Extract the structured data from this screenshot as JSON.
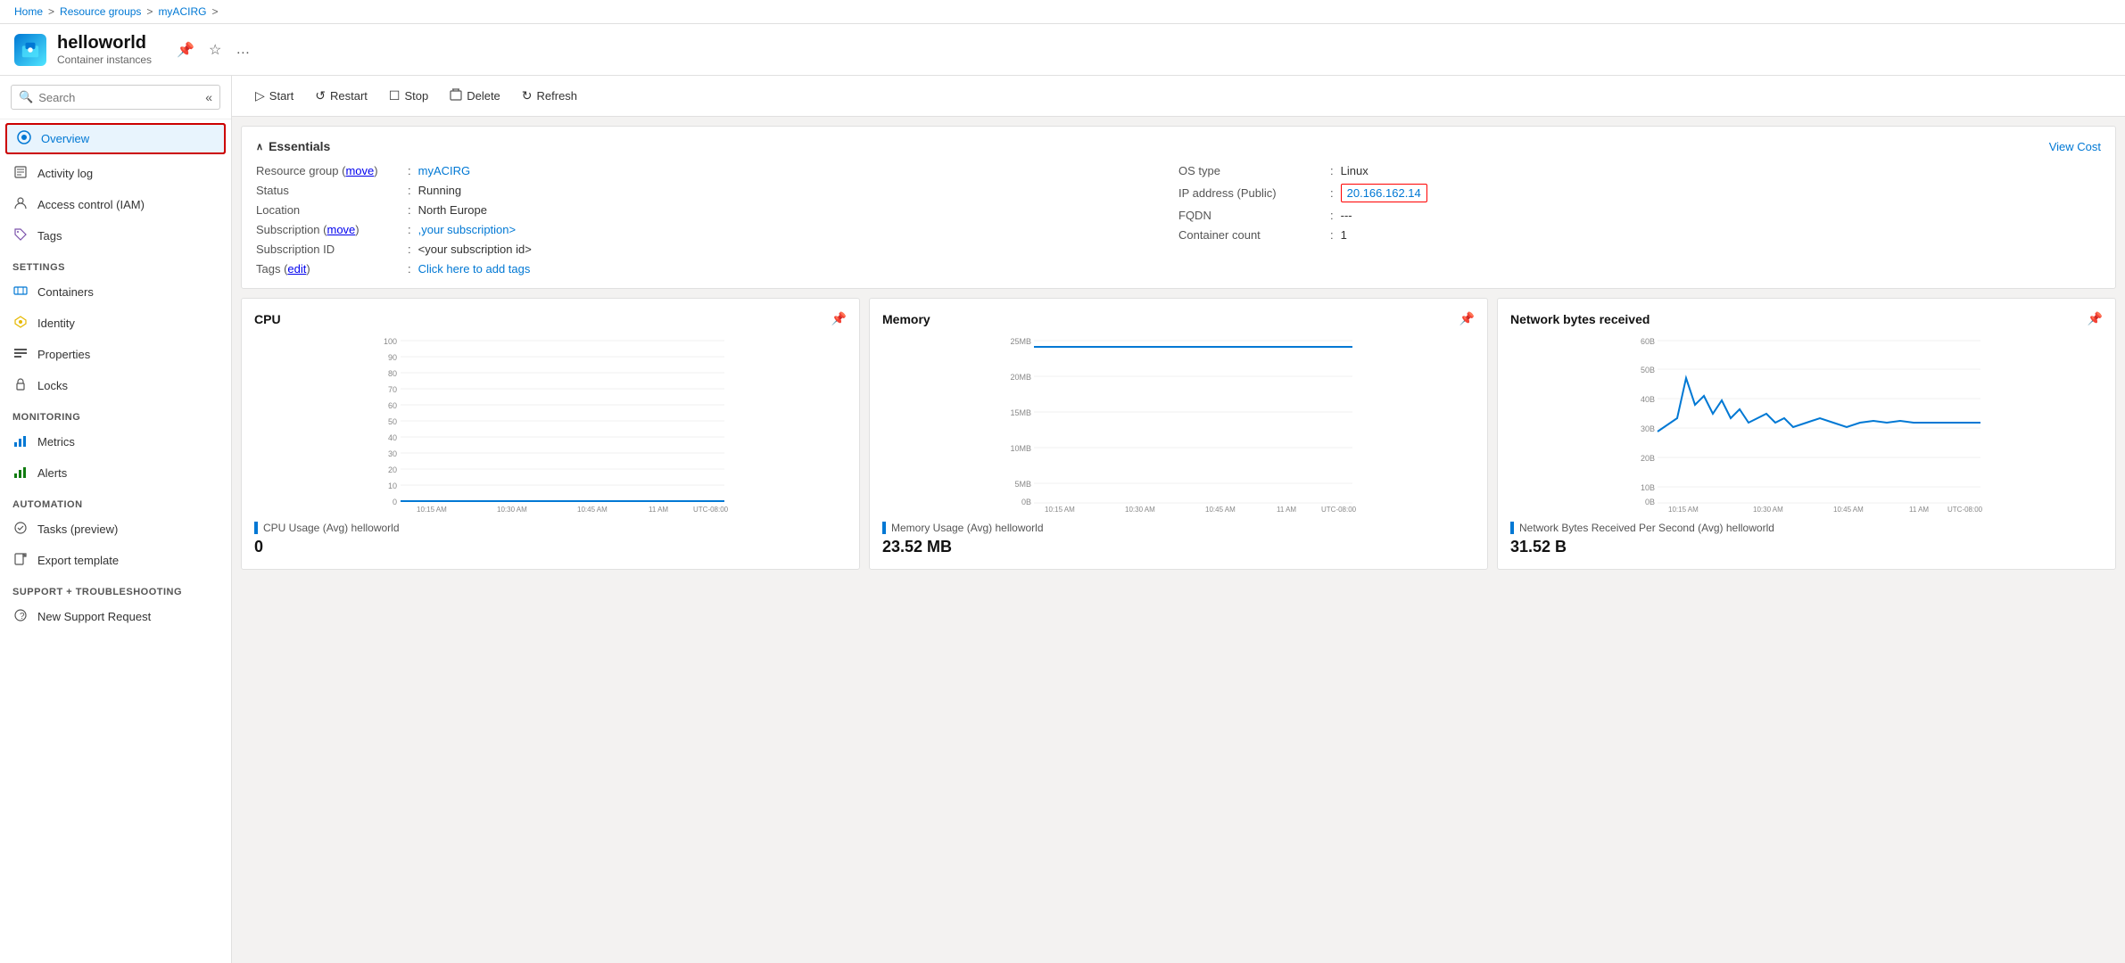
{
  "breadcrumb": {
    "items": [
      "Home",
      "Resource groups",
      "myACIRG"
    ],
    "separators": [
      ">",
      ">",
      ">"
    ]
  },
  "header": {
    "icon": "📦",
    "title": "helloworld",
    "subtitle": "Container instances",
    "actions": [
      "pin-icon",
      "favorite-icon",
      "more-icon"
    ]
  },
  "toolbar": {
    "buttons": [
      {
        "id": "start",
        "label": "Start",
        "icon": "▷"
      },
      {
        "id": "restart",
        "label": "Restart",
        "icon": "↺"
      },
      {
        "id": "stop",
        "label": "Stop",
        "icon": "☐"
      },
      {
        "id": "delete",
        "label": "Delete",
        "icon": "🗑"
      },
      {
        "id": "refresh",
        "label": "Refresh",
        "icon": "↻"
      }
    ]
  },
  "sidebar": {
    "search_placeholder": "Search",
    "items": [
      {
        "id": "overview",
        "label": "Overview",
        "icon": "🌐",
        "active": true,
        "section": null
      },
      {
        "id": "activity-log",
        "label": "Activity log",
        "icon": "📋",
        "active": false,
        "section": null
      },
      {
        "id": "access-control",
        "label": "Access control (IAM)",
        "icon": "👤",
        "active": false,
        "section": null
      },
      {
        "id": "tags",
        "label": "Tags",
        "icon": "🏷",
        "active": false,
        "section": null
      }
    ],
    "sections": [
      {
        "title": "Settings",
        "items": [
          {
            "id": "containers",
            "label": "Containers",
            "icon": "▦"
          },
          {
            "id": "identity",
            "label": "Identity",
            "icon": "✨"
          },
          {
            "id": "properties",
            "label": "Properties",
            "icon": "📊"
          },
          {
            "id": "locks",
            "label": "Locks",
            "icon": "🔒"
          }
        ]
      },
      {
        "title": "Monitoring",
        "items": [
          {
            "id": "metrics",
            "label": "Metrics",
            "icon": "📈"
          },
          {
            "id": "alerts",
            "label": "Alerts",
            "icon": "🔔"
          }
        ]
      },
      {
        "title": "Automation",
        "items": [
          {
            "id": "tasks",
            "label": "Tasks (preview)",
            "icon": "⚙"
          },
          {
            "id": "export-template",
            "label": "Export template",
            "icon": "📤"
          }
        ]
      },
      {
        "title": "Support + troubleshooting",
        "items": [
          {
            "id": "new-support",
            "label": "New Support Request",
            "icon": "❓"
          }
        ]
      }
    ]
  },
  "essentials": {
    "title": "Essentials",
    "view_cost_label": "View Cost",
    "left": [
      {
        "key": "Resource group (move)",
        "value": "myACIRG",
        "link": true,
        "link_label": "myACIRG"
      },
      {
        "key": "Status",
        "value": "Running",
        "link": false
      },
      {
        "key": "Location",
        "value": "North Europe",
        "link": false
      },
      {
        "key": "Subscription (move)",
        "value": ",your subscription>",
        "link": true,
        "link_label": ",your subscription>"
      },
      {
        "key": "Subscription ID",
        "value": "<your subscription id>",
        "link": false
      },
      {
        "key": "Tags (edit)",
        "value": "Click here to add tags",
        "link": true,
        "link_label": "Click here to add tags"
      }
    ],
    "right": [
      {
        "key": "OS type",
        "value": "Linux",
        "link": false,
        "highlight": false
      },
      {
        "key": "IP address (Public)",
        "value": "20.166.162.14",
        "link": false,
        "highlight": true
      },
      {
        "key": "FQDN",
        "value": "---",
        "link": false,
        "highlight": false
      },
      {
        "key": "Container count",
        "value": "1",
        "link": false,
        "highlight": false
      }
    ]
  },
  "charts": [
    {
      "id": "cpu",
      "title": "CPU",
      "legend": "CPU Usage (Avg) helloworld",
      "value": "0",
      "unit": "",
      "x_labels": [
        "10:15 AM",
        "10:30 AM",
        "10:45 AM",
        "11 AM",
        "UTC-08:00"
      ],
      "y_labels": [
        "100",
        "90",
        "80",
        "70",
        "60",
        "50",
        "40",
        "30",
        "20",
        "10",
        "0"
      ],
      "type": "flat"
    },
    {
      "id": "memory",
      "title": "Memory",
      "legend": "Memory Usage (Avg) helloworld",
      "value": "23.52 MB",
      "unit": "",
      "x_labels": [
        "10:15 AM",
        "10:30 AM",
        "10:45 AM",
        "11 AM",
        "UTC-08:00"
      ],
      "y_labels": [
        "25MB",
        "20MB",
        "15MB",
        "10MB",
        "5MB",
        "0B"
      ],
      "type": "flat_high"
    },
    {
      "id": "network",
      "title": "Network bytes received",
      "legend": "Network Bytes Received Per Second (Avg) helloworld",
      "value": "31.52 B",
      "unit": "",
      "x_labels": [
        "10:15 AM",
        "10:30 AM",
        "10:45 AM",
        "11 AM",
        "UTC-08:00"
      ],
      "y_labels": [
        "60B",
        "50B",
        "40B",
        "30B",
        "20B",
        "10B",
        "0B"
      ],
      "type": "spiky"
    }
  ]
}
